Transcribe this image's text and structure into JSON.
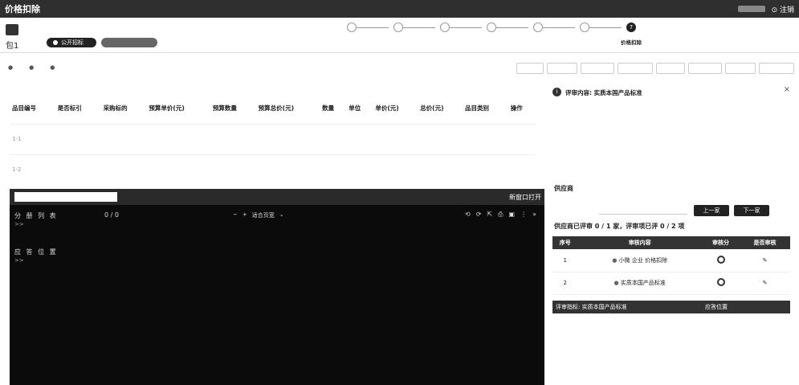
{
  "app": {
    "title": "价格扣除",
    "user_action": "⊙ 注销"
  },
  "package": {
    "label": "包1",
    "status_pill_1": "公开招标",
    "status_pill_2": ""
  },
  "steps": [
    {
      "label": "",
      "state": "pending"
    },
    {
      "label": "",
      "state": "pending"
    },
    {
      "label": "",
      "state": "pending"
    },
    {
      "label": "",
      "state": "pending"
    },
    {
      "label": "",
      "state": "pending"
    },
    {
      "label": "",
      "state": "pending"
    },
    {
      "label": "价格扣除",
      "state": "current",
      "number": "7"
    }
  ],
  "legend": [
    "",
    "",
    ""
  ],
  "toolbar_buttons": [
    "",
    "",
    "",
    "",
    "",
    "",
    "",
    ""
  ],
  "table": {
    "headers": [
      "品目编号",
      "是否标引",
      "采购标的",
      "预算单价(元)",
      "预算数量",
      "预算总价(元)",
      "数量",
      "单位",
      "单价(元)",
      "总价(元)",
      "品目类别",
      "操作"
    ],
    "rows": [
      [
        "1-1",
        "",
        "",
        "",
        "",
        "",
        "",
        "",
        "",
        "",
        "",
        ""
      ],
      [
        "1-2",
        "",
        "",
        "",
        "",
        "",
        "",
        "",
        "",
        "",
        "",
        ""
      ]
    ]
  },
  "console": {
    "open_in_new": "新窗口打开",
    "control_title": "分 册 列 表",
    "pager": "0 / 0",
    "zoom_label": "适合页宽",
    "prompt1": ">>",
    "section_title": "应 答 位 置",
    "prompt2": ">>"
  },
  "review": {
    "title": "评审内容: 实质本国产品标准",
    "body": "",
    "supplier_label": "供应商",
    "prev_button": "上一家",
    "next_button": "下一家",
    "progress": "供应商已评审 0 / 1 家，评审项已评 0 / 2 项",
    "headers": [
      "序号",
      "审核内容",
      "审核分",
      "是否审核"
    ],
    "rows": [
      {
        "index": "1",
        "content": "小微 企业 价格扣除",
        "action": "✎"
      },
      {
        "index": "2",
        "content": "实质本国产品标准",
        "action": "✎"
      }
    ],
    "bottom_headers": [
      "评审指标: 实质本国产品标准",
      "应答位置"
    ]
  }
}
